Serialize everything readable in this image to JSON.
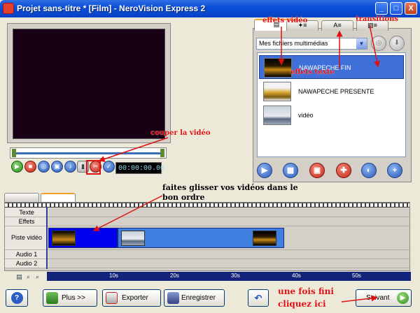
{
  "window": {
    "title": "Projet sans-titre * [Film] - NeroVision Express 2",
    "minimize_glyph": "_",
    "maximize_glyph": "□",
    "close_glyph": "X"
  },
  "preview": {
    "timecode": "00:00:00.00"
  },
  "media_panel": {
    "tabs": [
      "effets vidéo",
      "effets texte",
      "transitions"
    ],
    "source_select": "Mes fichiers multimédias",
    "items": [
      {
        "name": "NAWAPECHE FIN",
        "selected": true
      },
      {
        "name": "NAWAPECHE PRESENTE",
        "selected": false
      },
      {
        "name": "vidéo",
        "selected": false
      }
    ]
  },
  "timeline": {
    "tracks": [
      "Texte",
      "Effets",
      "Piste vidéo",
      "Audio 1",
      "Audio 2"
    ],
    "ruler_ticks": [
      "10s",
      "20s",
      "30s",
      "40s",
      "50s"
    ]
  },
  "bottom_bar": {
    "help_glyph": "?",
    "more_label": "Plus >>",
    "export_label": "Exporter",
    "save_label": "Enregistrer",
    "next_label": "Suivant"
  },
  "annotations": {
    "video_effects": "effets vidéo",
    "text_effects": "effets texte",
    "transitions": "transitions",
    "cut_video": "couper la vidéo",
    "drag_videos": "faites glisser vos vidéos dans le bon ordre",
    "done_line1": "une fois fini",
    "done_line2": "cliquez ici"
  },
  "colors": {
    "titlebar": "#0a4fd8",
    "annotation": "#e01010",
    "selection": "#3f6fd8",
    "timeline_ruler": "#13237a"
  },
  "icons": {
    "play": "play-icon",
    "stop": "stop-icon",
    "cut": "scissors-icon",
    "next": "green-arrow-icon"
  }
}
